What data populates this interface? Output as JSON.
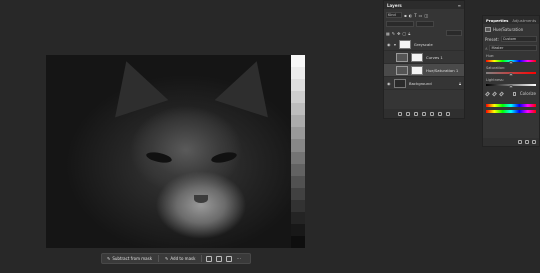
{
  "context_bar": {
    "subtract_label": "Subtract from mask",
    "add_label": "Add to mask",
    "more_label": "···"
  },
  "layers_panel": {
    "title": "Layers",
    "kind_label": "Kind",
    "layers": [
      {
        "name": "Greyscale",
        "type": "group"
      },
      {
        "name": "Curves 1",
        "type": "adjustment"
      },
      {
        "name": "Hue/Saturation 1",
        "type": "adjustment"
      },
      {
        "name": "Background",
        "type": "image"
      }
    ]
  },
  "properties_panel": {
    "tabs": [
      "Properties",
      "Adjustments"
    ],
    "header_label": "Hue/Saturation",
    "preset_label": "Preset:",
    "preset_value": "Custom",
    "channel_value": "Master",
    "hue_label": "Hue:",
    "saturation_label": "Saturation:",
    "lightness_label": "Lightness:",
    "colorize_label": "Colorize",
    "hue_level": 0.5,
    "saturation_level": 0.5,
    "lightness_level": 0.5
  },
  "gradient_strip_shades": [
    "#f8f8f8",
    "#ececec",
    "#dedede",
    "#cecece",
    "#bdbdbd",
    "#ababab",
    "#999999",
    "#878787",
    "#747474",
    "#626262",
    "#515151",
    "#414141",
    "#323232",
    "#242424",
    "#181818",
    "#0e0e0e"
  ]
}
